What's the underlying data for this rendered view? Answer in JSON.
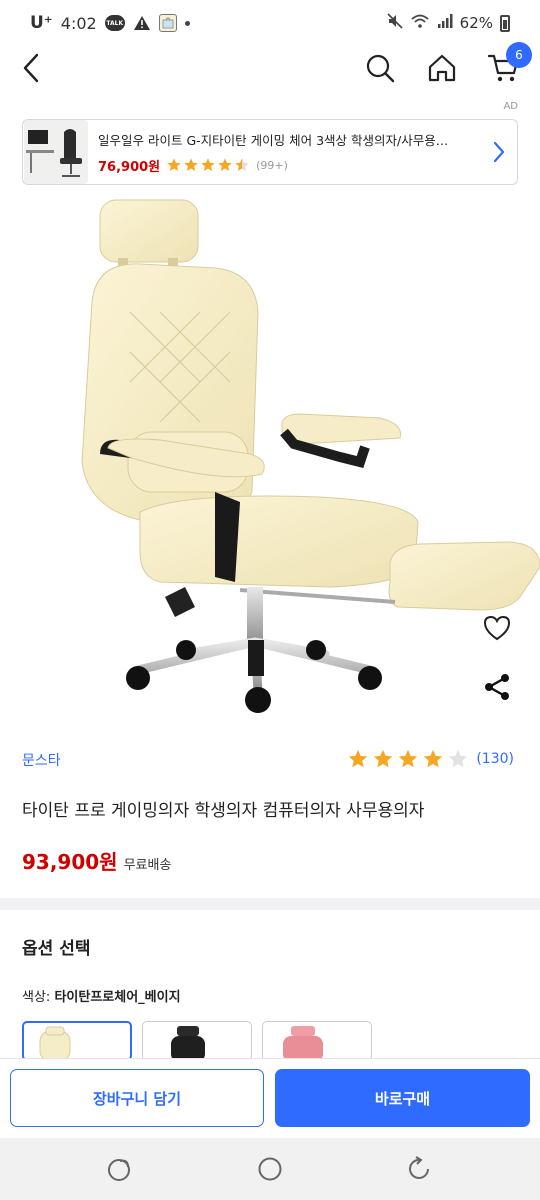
{
  "status_bar": {
    "carrier": "U⁺",
    "time": "4:02",
    "talk_icon_text": "TALK",
    "battery": "62%"
  },
  "header": {
    "cart_count": "6"
  },
  "ad": {
    "label": "AD",
    "title": "일우일우 라이트 G-지타이탄 게이밍 체어 3색상 학생의자/사무용…",
    "price": "76,900원",
    "rating": 4.5,
    "review_count": "(99+)"
  },
  "product": {
    "brand": "문스타",
    "rating": 4,
    "review_count": "(130)",
    "title": "타이탄 프로 게이밍의자 학생의자 컴퓨터의자 사무용의자",
    "price": "93,900원",
    "shipping": "무료배송"
  },
  "options": {
    "section_title": "옵션 선택",
    "color_label": "색상:",
    "selected_value": "타이탄프로체어_베이지",
    "swatches": [
      "beige",
      "black",
      "pink"
    ]
  },
  "actions": {
    "add_to_cart": "장바구니 담기",
    "buy_now": "바로구매"
  },
  "colors": {
    "accent": "#2f6bff",
    "price": "#d00000",
    "star": "#f5a623"
  }
}
